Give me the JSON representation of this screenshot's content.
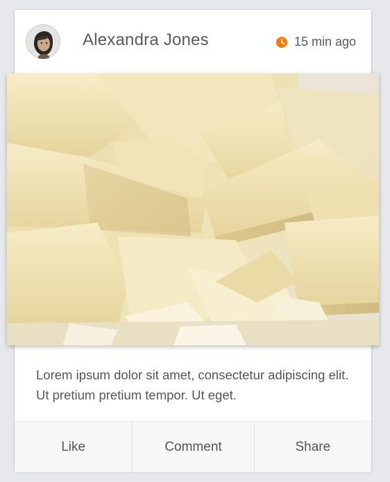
{
  "post": {
    "author": "Alexandra Jones",
    "timestamp": "15 min ago",
    "caption": "Lorem ipsum dolor sit amet, consectetur adipiscing elit. Ut pretium pretium tempor. Ut eget."
  },
  "actions": {
    "like": "Like",
    "comment": "Comment",
    "share": "Share"
  },
  "icons": {
    "avatar": "avatar",
    "timestamp": "clock-icon",
    "photo": "white-chocolate-photo"
  },
  "colors": {
    "accent": "#f57c00",
    "text": "#555555",
    "background": "#e6e8eb",
    "card": "#ffffff",
    "actions_bar": "#f7f7f7"
  }
}
